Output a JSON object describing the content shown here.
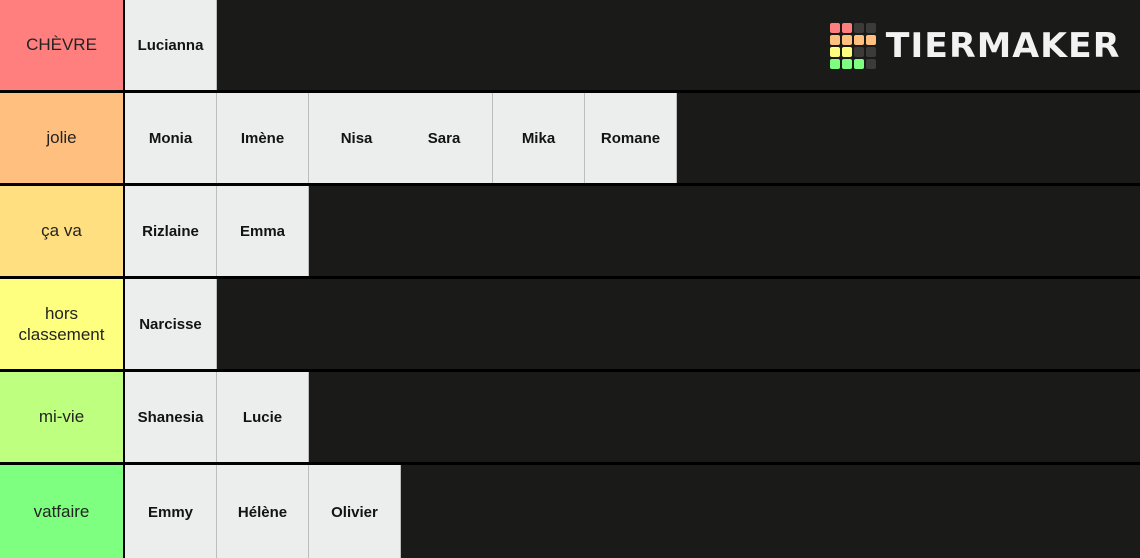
{
  "brand": {
    "name": "TIERMAKER",
    "logo_colors": [
      "#ff7f7f",
      "#ff7f7f",
      "#3b3b38",
      "#3b3b38",
      "#ffbf7f",
      "#ffbf7f",
      "#ffbf7f",
      "#ffbf7f",
      "#ffff7f",
      "#ffff7f",
      "#3b3b38",
      "#3b3b38",
      "#7fff7f",
      "#7fff7f",
      "#7fff7f",
      "#3b3b38"
    ]
  },
  "background_color": "#1a1a18",
  "item_color": "#eceded",
  "rows": [
    {
      "label": "CHÈVRE",
      "color": "#ff7f7f",
      "items": [
        {
          "text": "Lucianna",
          "wide": false
        }
      ]
    },
    {
      "label": "jolie",
      "color": "#ffbf7f",
      "items": [
        {
          "text": "Monia",
          "wide": false
        },
        {
          "text": "Imène",
          "wide": false
        },
        {
          "text": "Nisa",
          "text2": "Sara",
          "wide": true
        },
        {
          "text": "Mika",
          "wide": false
        },
        {
          "text": "Romane",
          "wide": false
        }
      ]
    },
    {
      "label": "ça va",
      "color": "#ffdf7f",
      "items": [
        {
          "text": "Rizlaine",
          "wide": false
        },
        {
          "text": "Emma",
          "wide": false
        }
      ]
    },
    {
      "label": "hors classement",
      "color": "#ffff7f",
      "items": [
        {
          "text": "Narcisse",
          "wide": false
        }
      ]
    },
    {
      "label": "mi-vie",
      "color": "#bfff7f",
      "items": [
        {
          "text": "Shanesia",
          "wide": false
        },
        {
          "text": "Lucie",
          "wide": false
        }
      ]
    },
    {
      "label": "vatfaire",
      "color": "#7fff7f",
      "items": [
        {
          "text": "Emmy",
          "wide": false
        },
        {
          "text": "Hélène",
          "wide": false
        },
        {
          "text": "Olivier",
          "wide": false
        }
      ]
    }
  ]
}
